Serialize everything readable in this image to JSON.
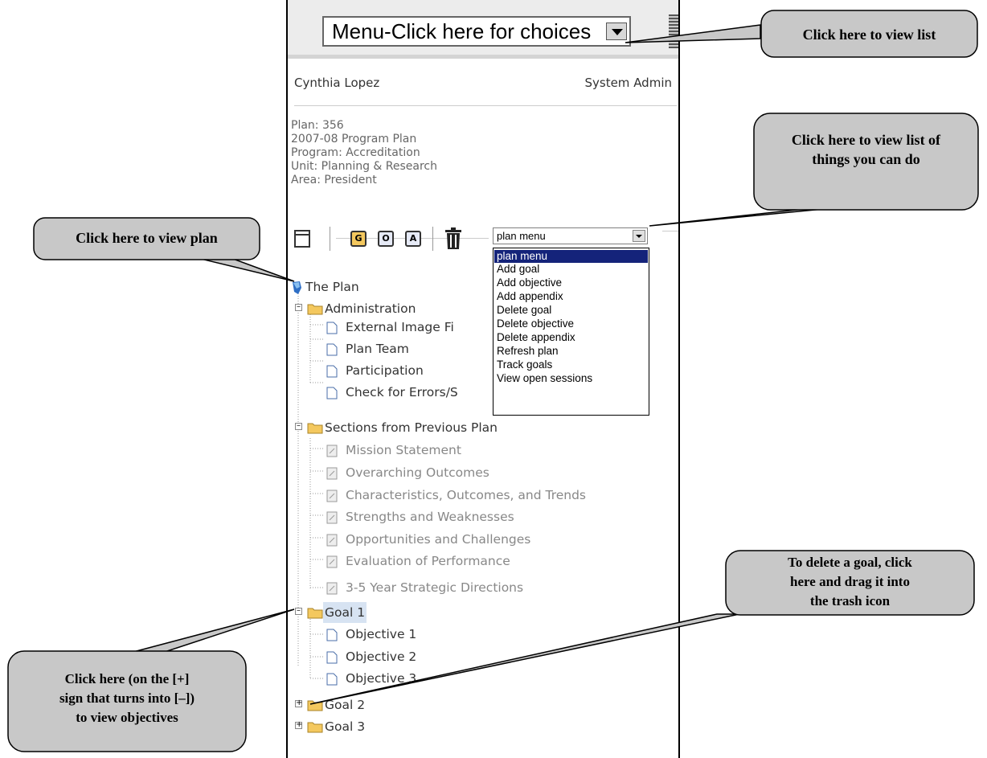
{
  "app": {
    "main_menu": {
      "value": "Menu-Click here for choices"
    },
    "user": {
      "name": "Cynthia Lopez",
      "role": "System Admin"
    },
    "plan_info": {
      "plan": "Plan: 356",
      "title": "2007-08 Program Plan",
      "program": "Program: Accreditation",
      "unit": "Unit: Planning & Research",
      "area": "Area: President"
    },
    "toolbar": {
      "goal_label": "G",
      "objective_label": "O",
      "appendix_label": "A"
    },
    "plan_menu": {
      "value": "plan menu",
      "options": [
        "plan menu",
        "Add goal",
        "Add objective",
        "Add appendix",
        "Delete goal",
        "Delete objective",
        "Delete appendix",
        "Refresh plan",
        "Track goals",
        "View open sessions"
      ],
      "selected_index": 0
    },
    "tree": {
      "root": "The Plan",
      "administration": {
        "label": "Administration",
        "items": [
          "External Image Fi",
          "Plan Team",
          "Participation",
          "Check for Errors/S"
        ]
      },
      "previous": {
        "label": "Sections from Previous Plan",
        "items": [
          "Mission Statement",
          "Overarching Outcomes",
          "Characteristics, Outcomes, and Trends",
          "Strengths and Weaknesses",
          "Opportunities and Challenges",
          "Evaluation of Performance",
          "3-5 Year Strategic Directions"
        ]
      },
      "goal1": {
        "label": "Goal 1",
        "items": [
          "Objective 1",
          "Objective 2",
          "Objective 3"
        ]
      },
      "goal2": {
        "label": "Goal 2"
      },
      "goal3": {
        "label": "Goal 3"
      }
    }
  },
  "callouts": {
    "view_list": "Click here to view list",
    "view_things": [
      "Click here to view list of",
      "things you can do"
    ],
    "view_plan": "Click here to view plan",
    "delete_goal": [
      "To delete a goal, click",
      "here and drag it into",
      "the trash icon"
    ],
    "view_objectives": [
      "Click here (on the [+]",
      "sign that turns into [–])",
      "to view objectives"
    ]
  },
  "colors": {
    "callout_fill": "#c8c8c8",
    "selection": "#14237a",
    "folder": "#f4c85e",
    "highlight": "#d7e3f2"
  }
}
